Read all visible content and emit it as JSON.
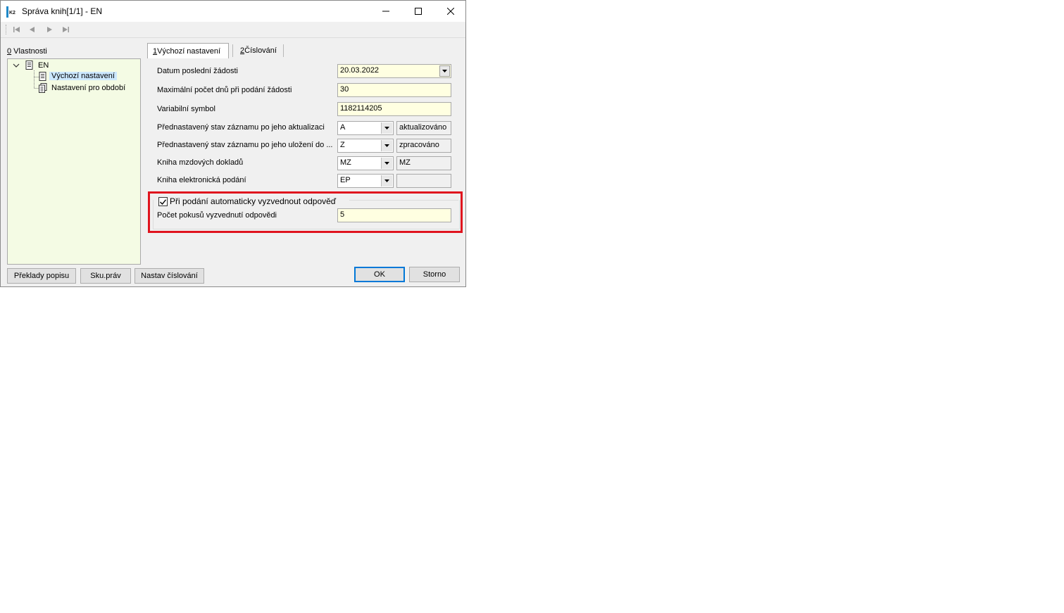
{
  "window": {
    "title": "Správa knih[1/1] - EN"
  },
  "left": {
    "section_label_key": "0",
    "section_label_rest": " Vlastnosti",
    "tree": {
      "root": "EN",
      "children": [
        "Výchozí nastavení",
        "Nastavení pro období"
      ]
    }
  },
  "tabs": [
    {
      "key": "1",
      "rest": " Výchozí nastavení"
    },
    {
      "key": "2",
      "rest": " Číslování"
    }
  ],
  "form": {
    "datum": {
      "label": "Datum poslední žádosti",
      "value": "20.03.2022"
    },
    "maxdnu": {
      "label": "Maximální počet dnů při podání žádosti",
      "value": "30"
    },
    "varsym": {
      "label": "Variabilní symbol",
      "value": "1182114205"
    },
    "stav_akt": {
      "label": "Přednastavený stav záznamu po jeho aktualizaci",
      "value": "A",
      "desc": "aktualizováno"
    },
    "stav_ulo": {
      "label": "Přednastavený stav záznamu po jeho uložení do ...",
      "value": "Z",
      "desc": "zpracováno"
    },
    "kniha_mzd": {
      "label": "Kniha mzdových dokladů",
      "value": "MZ",
      "desc": "MZ"
    },
    "kniha_el": {
      "label": "Kniha elektronická podání",
      "value": "EP",
      "desc": ""
    },
    "auto_check": {
      "label": "Při podání automaticky vyzvednout odpověď",
      "checked": true
    },
    "pokusy": {
      "label": "Počet pokusů vyzvednutí odpovědi",
      "value": "5"
    }
  },
  "buttons": {
    "preklady": "Překlady popisu",
    "skuprav": "Sku.práv",
    "nastav": "Nastav číslování",
    "ok": "OK",
    "storno": "Storno"
  },
  "colors": {
    "tree_bg": "#f4fbe4",
    "field_bg": "#ffffe1",
    "highlight": "#e0141e",
    "selection": "#cce8ff"
  }
}
